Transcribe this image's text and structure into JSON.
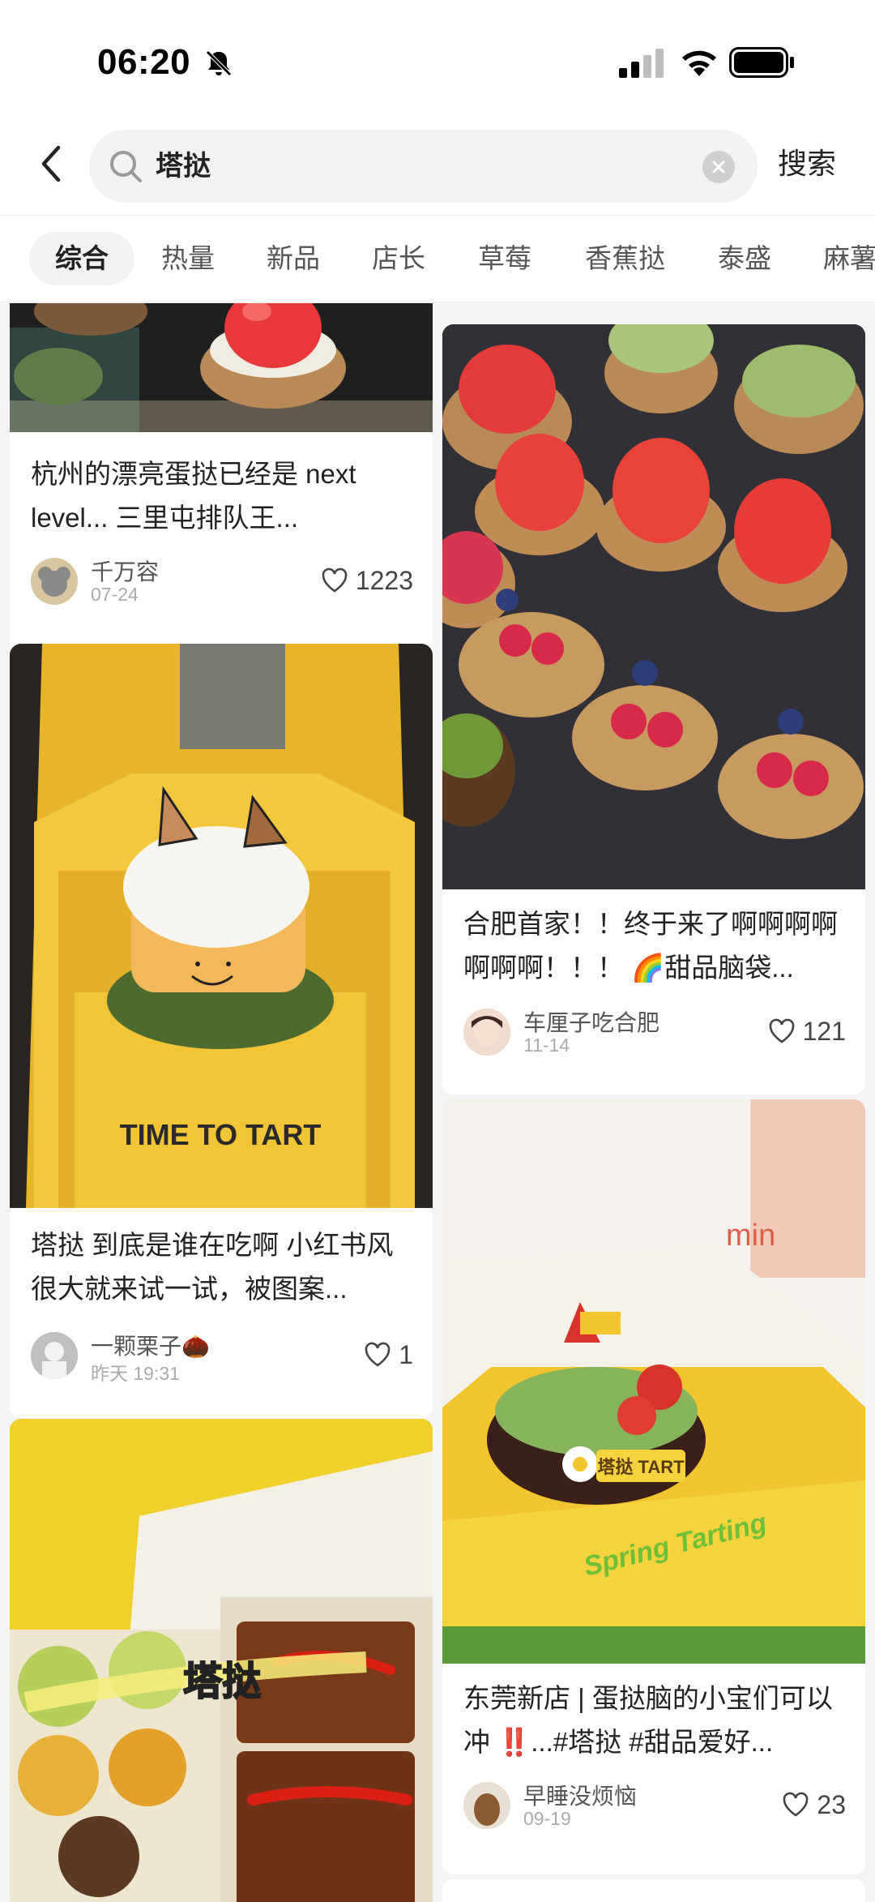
{
  "status": {
    "time": "06:20"
  },
  "search": {
    "query": "塔挞",
    "submit_label": "搜索"
  },
  "tabs": [
    "综合",
    "热量",
    "新品",
    "店长",
    "草莓",
    "香蕉挞",
    "泰盛",
    "麻薯"
  ],
  "feed": {
    "left": [
      {
        "title": "杭州的漂亮蛋挞已经是 next level... 三里屯排队王...",
        "author": "千万容",
        "date": "07-24",
        "likes": "1223",
        "image": "tart-tray-photo"
      },
      {
        "title": "塔挞 到底是谁在吃啊 小红书风很大就来试一试，被图案...",
        "author": "一颗栗子🌰",
        "date": "昨天 19:31",
        "likes": "1",
        "image": "cat-cake-box-photo",
        "box_text": "TIME TO TART"
      },
      {
        "image": "egg-tarts-box-photo",
        "overlay_text": "塔挞"
      }
    ],
    "right": [
      {
        "title": "合肥首家！！终于来了啊啊啊啊啊啊啊！！！ 🌈甜品脑袋...",
        "author": "车厘子吃合肥",
        "date": "11-14",
        "likes": "121",
        "image": "peach-raspberry-tarts-photo"
      },
      {
        "title": "东莞新店 | 蛋挞脑的小宝们可以冲 ‼️...#塔挞 #甜品爱好...",
        "author": "早睡没烦恼",
        "date": "09-19",
        "likes": "23",
        "image": "matcha-cake-box-photo",
        "cake_text": "塔挞 TART",
        "box_text": "Spring Tarting"
      }
    ]
  },
  "colors": {
    "accent": "#ff2442",
    "yellow_box": "#f2c12e",
    "text_main": "#222222",
    "text_sub": "#999999"
  }
}
